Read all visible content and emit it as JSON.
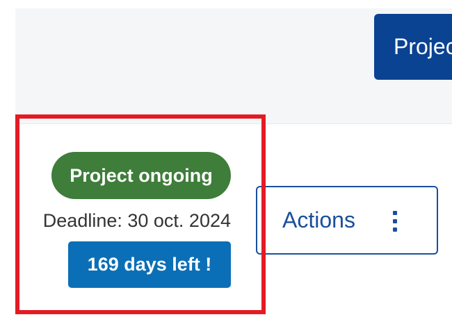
{
  "header": {
    "project_button_label": "Projects"
  },
  "project_status": {
    "status_label": "Project ongoing",
    "deadline_text": "Deadline: 30 oct. 2024",
    "days_left_label": "169 days left !",
    "status_color": "#3f7d3a",
    "days_left_color": "#0a6fb6"
  },
  "actions": {
    "label": "Actions",
    "icon": "kebab-vertical-icon"
  },
  "colors": {
    "primary": "#0b4393",
    "highlight": "#e31b23",
    "header_background": "#f5f6f8"
  }
}
